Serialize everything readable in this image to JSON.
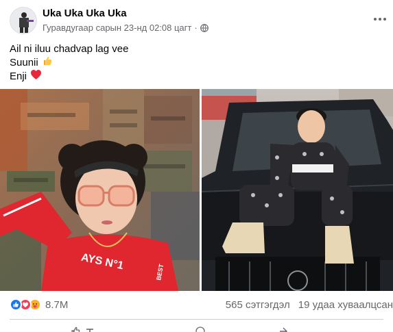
{
  "post": {
    "author": "Uka Uka Uka Uka",
    "timestamp": "Гуравдугаар сарын 23-нд 02:08 цагт",
    "separator": "·",
    "privacy_icon": "globe-icon",
    "more_icon": "more-options-icon",
    "text_lines": [
      {
        "text": "Ail ni iluu chadvap lag vee",
        "emoji": ""
      },
      {
        "text": "Suunii",
        "emoji": "👍"
      },
      {
        "text": "Enji",
        "emoji": "❤️"
      }
    ]
  },
  "photos": [
    {
      "name": "photo-girl-red-shirt",
      "alt": "Girl in red shirt with sunglasses in front of painted wall"
    },
    {
      "name": "photo-girl-on-car",
      "alt": "Girl sitting on black car hood"
    }
  ],
  "engagement": {
    "reaction_icons": [
      "like-reaction-icon",
      "love-reaction-icon",
      "care-reaction-icon"
    ],
    "reaction_count": "8.7M",
    "comments": "565 сэтгэгдэл",
    "shares": "19 удаа хуваалцсан"
  },
  "colors": {
    "primary_text": "#050505",
    "secondary_text": "#65676b",
    "like_blue": "#1877f2",
    "love_red": "#f33e58",
    "care_yellow": "#f7b125",
    "divider": "#ced0d4"
  }
}
